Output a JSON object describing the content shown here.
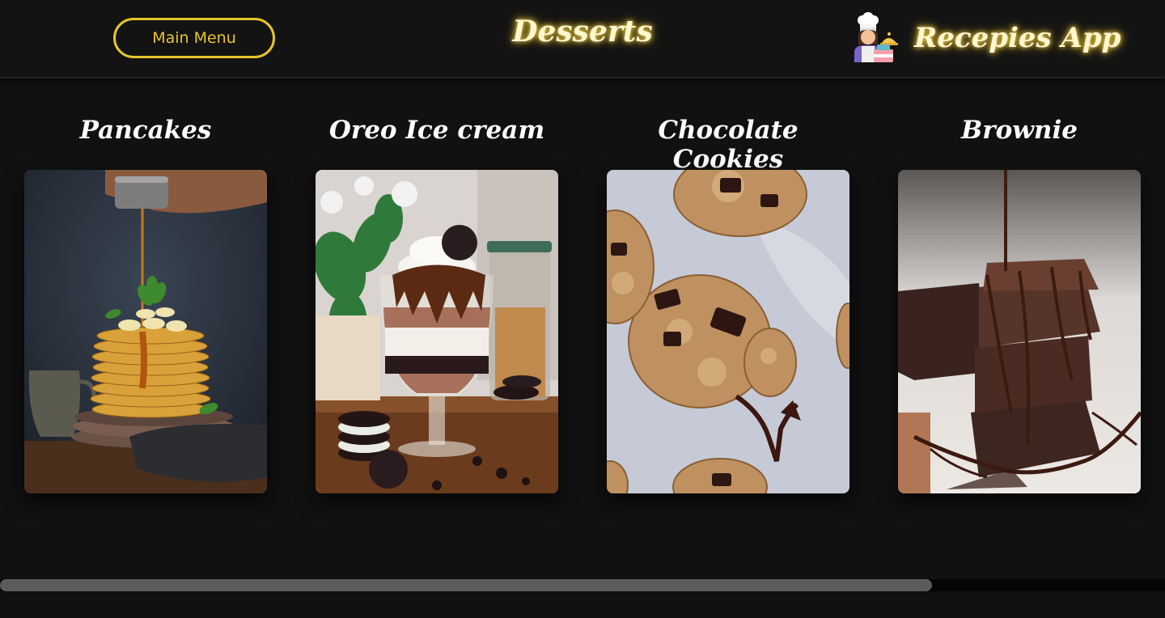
{
  "header": {
    "main_menu_label": "Main Menu",
    "page_title": "Desserts",
    "brand_name": "Recepies App",
    "brand_icon": "chef-icon"
  },
  "cards": [
    {
      "title": "Pancakes",
      "image": "pancakes-photo"
    },
    {
      "title": "Oreo Ice cream",
      "image": "oreo-ice-cream-photo"
    },
    {
      "title": "Chocolate Cookies",
      "image": "chocolate-cookies-photo"
    },
    {
      "title": "Brownie",
      "image": "brownie-photo"
    }
  ],
  "scrollbar": {
    "visible_fraction": 0.8
  },
  "colors": {
    "accent": "#e7c52a",
    "background": "#111111",
    "header_bg": "#131313"
  }
}
